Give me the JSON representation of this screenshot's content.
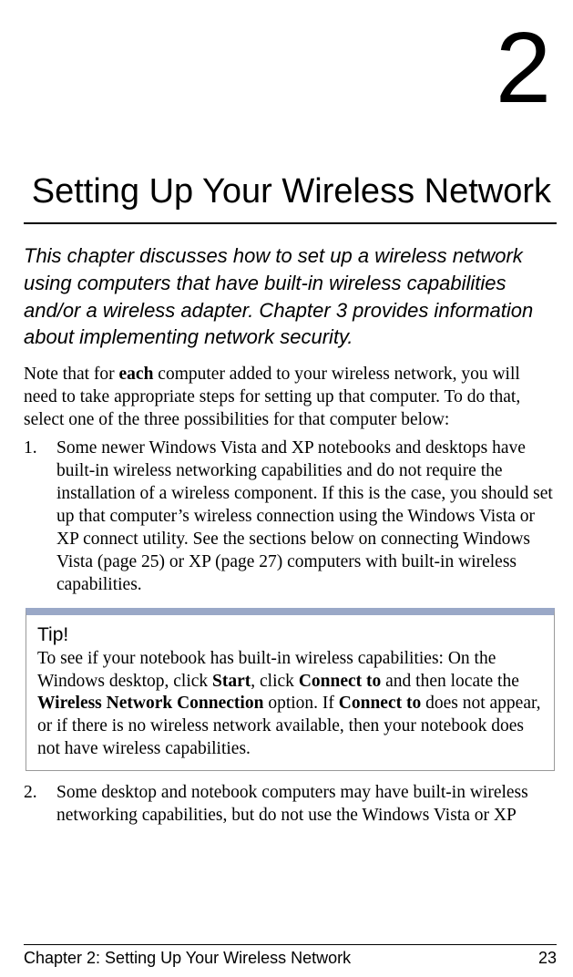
{
  "chapter": {
    "number": "2",
    "title": "Setting Up Your Wireless Network"
  },
  "intro": "This chapter discusses how to set up a wireless network using computers that have built-in wireless capabilities and/or a wireless adapter. Chapter 3 provides information about implementing network security.",
  "note": {
    "before": "Note that for ",
    "bold": "each",
    "after": " computer added to your wireless network, you will need to take appropriate steps for setting up that computer. To do that, select one of the three possibilities for that computer below:"
  },
  "list": {
    "item1": {
      "num": "1.",
      "text": "Some newer Windows Vista and XP notebooks and desktops have built-in wireless networking capabilities and do not require the installation of a wireless component. If this is the case, you should set up that computer’s wireless connection using the Windows Vista or XP connect utility. See the sections below on connecting Windows Vista (page 25) or XP (page 27) computers with built-in wireless capabilities."
    },
    "item2": {
      "num": "2.",
      "text": "Some desktop and notebook computers may have built-in wireless networking capabilities, but do not use the Windows Vista or XP"
    }
  },
  "tip": {
    "heading": "Tip!",
    "p1": "To see if your notebook has built-in wireless capabilities: On the Windows desktop, click ",
    "b1": "Start",
    "p2": ", click ",
    "b2": "Connect to",
    "p3": " and then locate the ",
    "b3": "Wireless Network Connection",
    "p4": " option. If ",
    "b4": "Connect to",
    "p5": " does not appear, or if there is no wireless network available, then your notebook does not have wireless capabilities."
  },
  "footer": {
    "left": "Chapter 2: Setting Up Your Wireless Network",
    "right": "23"
  }
}
